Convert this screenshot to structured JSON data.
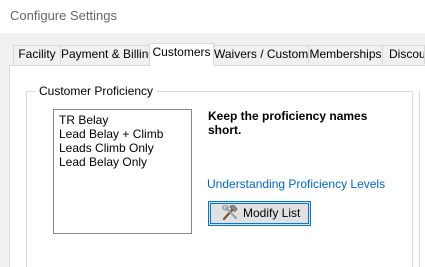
{
  "window": {
    "title": "Configure Settings"
  },
  "tabs": [
    {
      "label": "Facility",
      "active": false
    },
    {
      "label": "Payment & Billing",
      "active": false
    },
    {
      "label": "Customers",
      "active": true
    },
    {
      "label": "Waivers / Custom",
      "active": false
    },
    {
      "label": "Memberships",
      "active": false
    },
    {
      "label": "Discou",
      "active": false
    }
  ],
  "customer_proficiency": {
    "group_title": "Customer Proficiency",
    "levels": [
      "TR Belay",
      "Lead Belay + Climb",
      "Leads Climb Only",
      "Lead Belay Only"
    ],
    "hint": "Keep the proficiency names short.",
    "help_link": "Understanding Proficiency Levels",
    "modify_button": {
      "label": "Modify List",
      "icon": "hammer-wrench-icon"
    }
  },
  "colors": {
    "link": "#0066cc",
    "focus_border": "#0078d7"
  }
}
